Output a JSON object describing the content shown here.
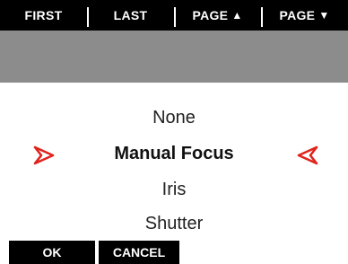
{
  "nav": {
    "first": "FIRST",
    "last": "LAST",
    "page_up": "PAGE",
    "page_down": "PAGE"
  },
  "options": [
    "None",
    "Manual Focus",
    "Iris",
    "Shutter"
  ],
  "selected_index": 1,
  "buttons": {
    "ok": "OK",
    "cancel": "CANCEL"
  },
  "colors": {
    "accent_arrow": "#e0231c",
    "bar_bg": "#000000",
    "header_grey": "#8c8c8c"
  },
  "icons": {
    "left_selector": "triangle-right-icon",
    "right_selector": "triangle-left-icon"
  }
}
